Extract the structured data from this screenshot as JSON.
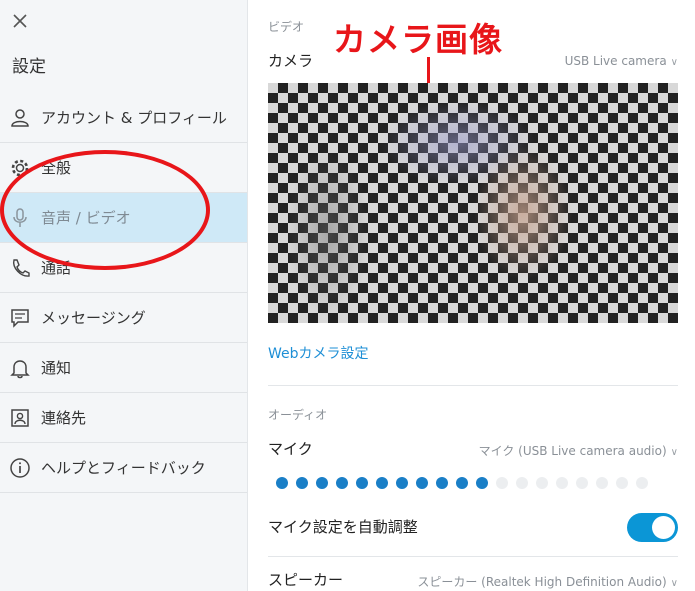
{
  "sidebar": {
    "title": "設定",
    "items": [
      {
        "label": "アカウント & プロフィール",
        "icon": "person-icon",
        "name": "account-profile"
      },
      {
        "label": "全般",
        "icon": "gear-icon",
        "name": "general"
      },
      {
        "label": "音声 / ビデオ",
        "icon": "microphone-icon",
        "name": "audio-video",
        "active": true
      },
      {
        "label": "通話",
        "icon": "phone-icon",
        "name": "calls"
      },
      {
        "label": "メッセージング",
        "icon": "chat-icon",
        "name": "messaging"
      },
      {
        "label": "通知",
        "icon": "bell-icon",
        "name": "notifications"
      },
      {
        "label": "連絡先",
        "icon": "contact-card-icon",
        "name": "contacts"
      },
      {
        "label": "ヘルプとフィードバック",
        "icon": "info-icon",
        "name": "help-feedback"
      }
    ]
  },
  "video": {
    "section_label": "ビデオ",
    "camera_label": "カメラ",
    "camera_value": "USB Live camera",
    "webcam_settings_link": "Webカメラ設定"
  },
  "audio": {
    "section_label": "オーディオ",
    "mic_label": "マイク",
    "mic_value": "マイク (USB Live camera audio)",
    "mic_level": {
      "active_dots": 11,
      "total_dots": 19
    },
    "auto_adjust_label": "マイク設定を自動調整",
    "auto_adjust_on": true,
    "speaker_label": "スピーカー",
    "speaker_value": "スピーカー (Realtek High Definition Audio)"
  },
  "annotations": {
    "camera_image_label": "カメラ画像"
  },
  "colors": {
    "accent": "#0b96d6",
    "link": "#1e8fd6",
    "active_item_bg": "#cfe9f7",
    "annotation": "#e8161a"
  }
}
